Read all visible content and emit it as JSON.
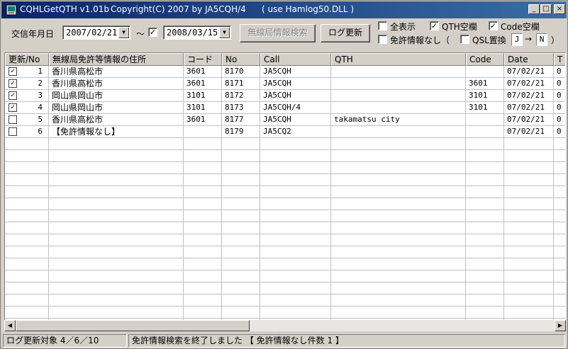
{
  "window": {
    "title": "CQHLGetQTH v1.01b",
    "copyright": "Copyright(C) 2007  by  JA5CQH/4",
    "dll_note": "( use Hamlog50.DLL )",
    "minimize": "_",
    "maximize": "□",
    "close": "×"
  },
  "toolbar": {
    "date_label": "交信年月日",
    "date_from": "2007/02/21",
    "tilde": "～",
    "date_to_enabled": true,
    "date_to": "2008/03/15",
    "search_button": "無線局情報検索",
    "update_button": "ログ更新",
    "show_all_label": "全表示",
    "show_all_checked": false,
    "qth_blank_label": "QTH空欄",
    "qth_blank_checked": true,
    "code_blank_label": "Code空欄",
    "code_blank_checked": true,
    "no_license_label": "免許情報なし（",
    "no_license_checked": false,
    "qsl_replace_label": "QSL置換",
    "qsl_replace_checked": false,
    "qsl_from": "J",
    "arrow": "→",
    "qsl_to": "N",
    "close_paren": "）"
  },
  "grid": {
    "columns": [
      "更新/No",
      "無線局免許等情報の住所",
      "コード",
      "No",
      "Call",
      "QTH",
      "Code",
      "Date",
      "T"
    ],
    "rows": [
      {
        "checked": true,
        "no": "1",
        "address": "香川県高松市",
        "code": "3601",
        "num": "8170",
        "call": "JA5CQH",
        "qth": "",
        "code2": "",
        "date": "07/02/21",
        "t": "0"
      },
      {
        "checked": true,
        "no": "2",
        "address": "香川県高松市",
        "code": "3601",
        "num": "8171",
        "call": "JA5CQH",
        "qth": "",
        "code2": "3601",
        "date": "07/02/21",
        "t": "0"
      },
      {
        "checked": true,
        "no": "3",
        "address": "岡山県岡山市",
        "code": "3101",
        "num": "8172",
        "call": "JA5CQH",
        "qth": "",
        "code2": "3101",
        "date": "07/02/21",
        "t": "0"
      },
      {
        "checked": true,
        "no": "4",
        "address": "岡山県岡山市",
        "code": "3101",
        "num": "8173",
        "call": "JA5CQH/4",
        "qth": "",
        "code2": "3101",
        "date": "07/02/21",
        "t": "0"
      },
      {
        "checked": false,
        "no": "5",
        "address": "香川県高松市",
        "code": "3601",
        "num": "8177",
        "call": "JA5CQH",
        "qth": "takamatsu city",
        "code2": "",
        "date": "07/02/21",
        "t": "0"
      },
      {
        "checked": false,
        "no": "6",
        "address": "【免許情報なし】",
        "code": "",
        "num": "8179",
        "call": "JA5CQ2",
        "qth": "",
        "code2": "",
        "date": "07/02/21",
        "t": "0"
      }
    ]
  },
  "status": {
    "left": "ログ更新対象 4／6／10",
    "right": "免許情報検索を終了しました 【 免許情報なし件数 1 】"
  }
}
